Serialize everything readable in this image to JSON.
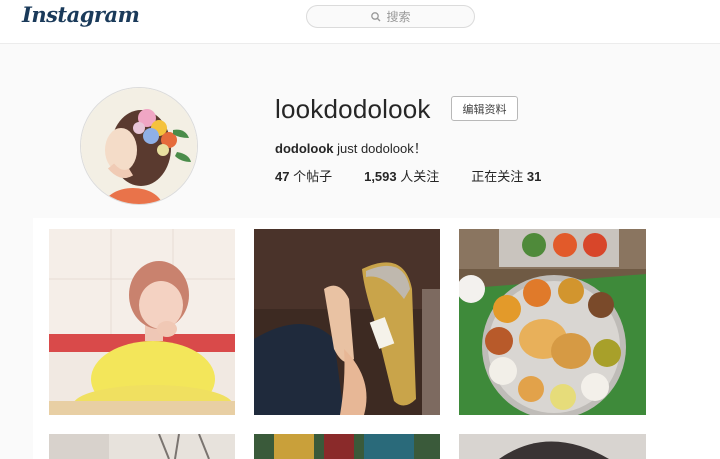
{
  "header": {
    "logo": "Instagram",
    "search_placeholder": "搜索",
    "search_icon": "search-icon"
  },
  "profile": {
    "username": "lookdodolook",
    "edit_button": "编辑资料",
    "bio_name": "dodolook",
    "bio_text": " just dodolook！",
    "stats": {
      "posts_count": "47",
      "posts_label": " 个帖子",
      "followers_count": "1,593",
      "followers_label": " 人关注",
      "following_label": "正在关注 ",
      "following_count": "31"
    }
  },
  "posts": [
    {
      "subject": "girl-yellow-sweater"
    },
    {
      "subject": "shoe-legs"
    },
    {
      "subject": "thali-meal"
    },
    {
      "subject": "row2-a"
    },
    {
      "subject": "row2-b"
    },
    {
      "subject": "row2-c"
    }
  ]
}
